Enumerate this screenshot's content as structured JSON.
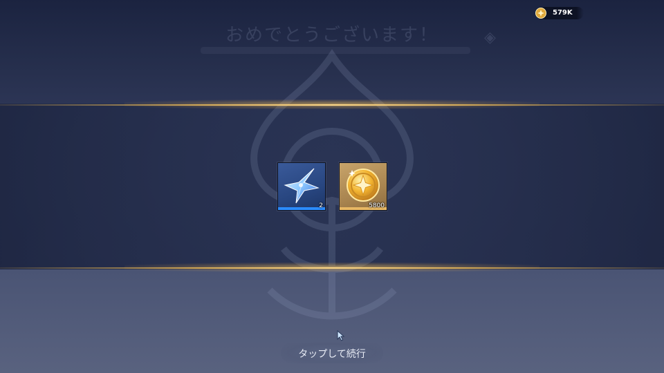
{
  "currency": {
    "icon": "gold-coin-icon",
    "value": "579K"
  },
  "background": {
    "title": "おめでとうございます！"
  },
  "rewards": [
    {
      "icon": "blue-crystal-star-icon",
      "count": "2",
      "accent": "#2b8cff"
    },
    {
      "icon": "gold-star-coin-icon",
      "count": "5800",
      "accent": "#e8b864"
    }
  ],
  "continue": {
    "label": "タップして続行"
  },
  "colors": {
    "gold_line": "#ffd98a",
    "background": "#27304d"
  }
}
